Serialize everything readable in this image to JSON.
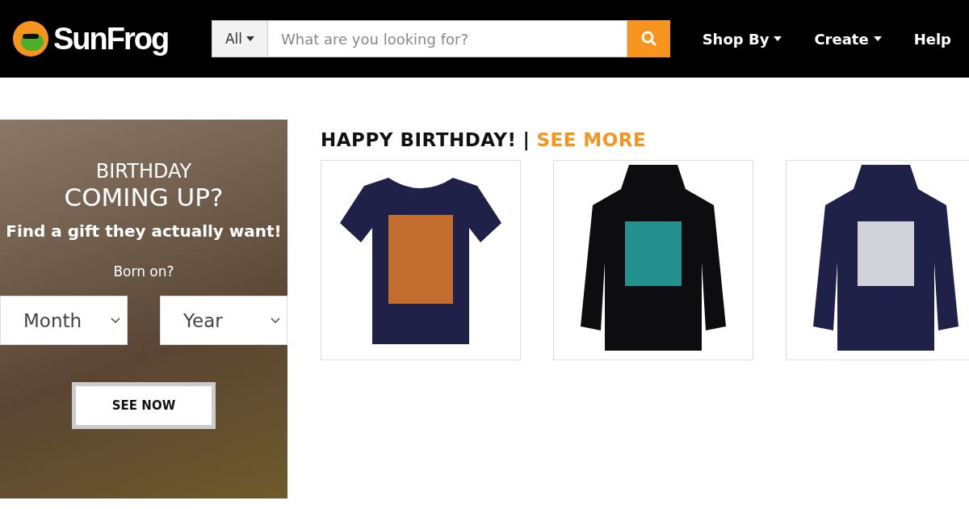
{
  "header": {
    "logo_text": "SunFrog",
    "search": {
      "category": "All",
      "placeholder": "What are you looking for?"
    },
    "nav": [
      {
        "label": "Shop By",
        "dropdown": true
      },
      {
        "label": "Create",
        "dropdown": true
      },
      {
        "label": "Help",
        "dropdown": false
      }
    ]
  },
  "promo": {
    "title_line1": "BIRTHDAY",
    "title_line2": "COMING UP?",
    "subtitle": "Find a gift they actually want!",
    "prompt": "Born on?",
    "selects": [
      {
        "placeholder": "Month"
      },
      {
        "placeholder": "Year"
      }
    ],
    "button": "SEE NOW"
  },
  "section": {
    "title": "HAPPY BIRTHDAY!",
    "separator": "|",
    "link": "SEE MORE"
  },
  "products": [
    {
      "kind": "tshirt"
    },
    {
      "kind": "hoodie"
    },
    {
      "kind": "hoodie"
    }
  ]
}
